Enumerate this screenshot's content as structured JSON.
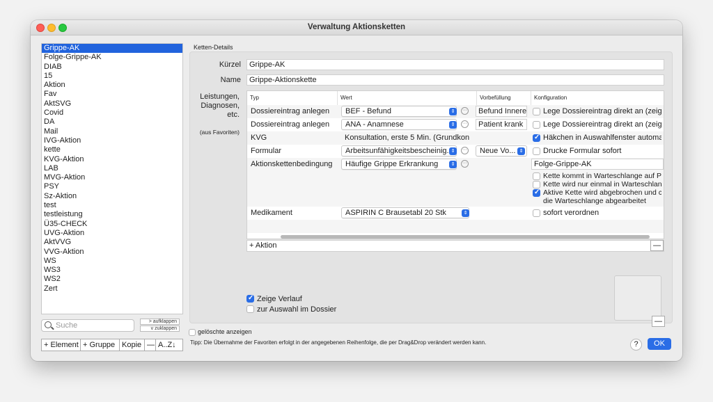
{
  "window": {
    "title": "Verwaltung Aktionsketten"
  },
  "left_list": {
    "items": [
      "Grippe-AK",
      "Folge-Grippe-AK",
      "DIAB",
      "15",
      "Aktion",
      "Fav",
      "AktSVG",
      "Covid",
      "DA",
      "Mail",
      "IVG-Aktion",
      "kette",
      "KVG-Aktion",
      "LAB",
      "MVG-Aktion",
      "PSY",
      "Sz-Aktion",
      "test",
      "testleistung",
      "Ü35-CHECK",
      "UVG-Aktion",
      "AktVVG",
      "VVG-Aktion",
      "WS",
      "WS3",
      "WS2",
      "Zert"
    ],
    "selected_index": 0
  },
  "search": {
    "placeholder": "Suche"
  },
  "expand": {
    "expand_label": "> aufklappen",
    "collapse_label": "v zuklappen"
  },
  "toolbar": {
    "add_element": "+ Element",
    "add_group": "+ Gruppe",
    "copy": "Kopie",
    "minus": "—",
    "sort": "A..Z↓"
  },
  "show_deleted": {
    "label": "gelöschte anzeigen",
    "checked": false
  },
  "details": {
    "section_label": "Ketten-Details",
    "kuerzel_label": "Kürzel",
    "kuerzel_value": "Grippe-AK",
    "name_label": "Name",
    "name_value": "Grippe-Aktionskette",
    "leistungen_label_1": "Leistungen,",
    "leistungen_label_2": "Diagnosen,",
    "leistungen_label_3": "etc.",
    "favoriten_label": "(aus Favoriten)"
  },
  "table": {
    "headers": [
      "Typ",
      "Wert",
      "Vorbefüllung",
      "Konfiguration"
    ],
    "rows": [
      {
        "typ": "Dossiereintrag anlegen",
        "wert": "BEF - Befund",
        "vorbefuellung": "Befund Innereie",
        "konfig": [
          "Lege Dossiereintrag direkt an (zeige"
        ],
        "konfig_checked": [
          false
        ]
      },
      {
        "typ": "Dossiereintrag anlegen",
        "wert": "ANA - Anamnese",
        "vorbefuellung": "Patient krank",
        "konfig": [
          "Lege Dossiereintrag direkt an (zeige"
        ],
        "konfig_checked": [
          false
        ]
      },
      {
        "typ": "KVG",
        "wert": "Konsultation, erste 5 Min. (Grundkon...",
        "vorbefuellung": "",
        "konfig": [
          "Häkchen in Auswahlfenster automati"
        ],
        "konfig_checked": [
          true
        ]
      },
      {
        "typ": "Formular",
        "wert": "Arbeitsunfähigkeitsbescheinig...",
        "vorbefuellung": "Neue Vo...",
        "konfig": [
          "Drucke Formular sofort"
        ],
        "konfig_checked": [
          false
        ]
      },
      {
        "typ": "Aktionskettenbedingung",
        "wert": "Häufige Grippe Erkrankung",
        "vorbefuellung": "",
        "konfig_title": "Folge-Grippe-AK",
        "konfig": [
          "Kette kommt in Warteschlange auf P",
          "Kette wird nur einmal in Warteschlan",
          "Aktive Kette wird abgebrochen und c"
        ],
        "konfig_extra": "die Warteschlange abgearbeitet",
        "konfig_checked": [
          false,
          false,
          true
        ]
      },
      {
        "typ": "Medikament",
        "wert": "ASPIRIN C Brausetabl 20 Stk",
        "vorbefuellung": "",
        "konfig": [
          "sofort verordnen"
        ],
        "konfig_checked": [
          false
        ]
      }
    ],
    "add_label": "+ Aktion",
    "remove_label": "—"
  },
  "options": {
    "zeige_verlauf": "Zeige Verlauf",
    "zeige_verlauf_checked": true,
    "zur_auswahl": "zur Auswahl im Dossier",
    "zur_auswahl_checked": false
  },
  "preview_remove": "—",
  "tip": "Tipp: Die Übernahme der Favoriten erfolgt in der angegebenen Reihenfolge, die per Drag&Drop verändert werden kann.",
  "help": "?",
  "ok": "OK",
  "icons": {
    "updown": "updown-icon",
    "ellipsis": "ellipsis-icon",
    "search": "search-icon"
  },
  "colors": {
    "accent": "#2a6de6",
    "selection": "#2163dd"
  }
}
